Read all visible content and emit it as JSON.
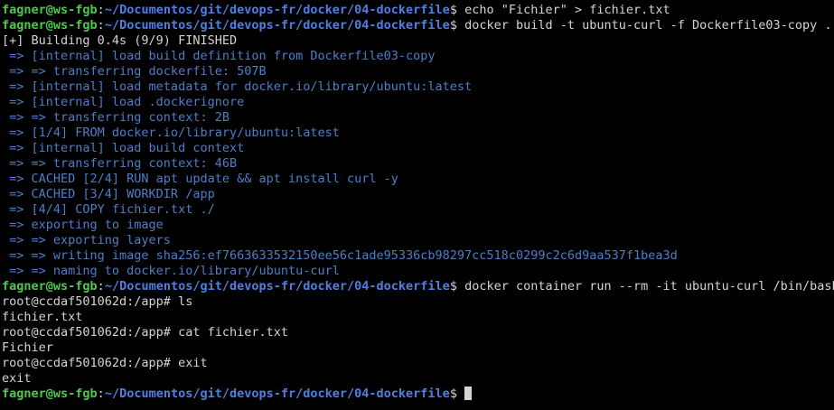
{
  "colors": {
    "background": "#000000",
    "user_host": "#4ec94e",
    "path": "#4f7fe3",
    "text": "#d4d4d4",
    "build_output": "#4e7ec9"
  },
  "terminal": {
    "prompt_user": "fagner@ws-fgb",
    "prompt_sep": ":",
    "prompt_path": "~/Documentos/git/devops-fr/docker/04-dockerfile",
    "prompt_dollar": "$ ",
    "container_prompt": "root@ccdaf501062d:/app# ",
    "lines": [
      {
        "type": "prompt",
        "command": "echo \"Fichier\" > fichier.txt"
      },
      {
        "type": "prompt",
        "command": "docker build -t ubuntu-curl -f Dockerfile03-copy ."
      },
      {
        "type": "plain",
        "text": "[+] Building 0.4s (9/9) FINISHED"
      },
      {
        "type": "build",
        "text": " => [internal] load build definition from Dockerfile03-copy"
      },
      {
        "type": "build",
        "text": " => => transferring dockerfile: 507B"
      },
      {
        "type": "build",
        "text": " => [internal] load metadata for docker.io/library/ubuntu:latest"
      },
      {
        "type": "build",
        "text": " => [internal] load .dockerignore"
      },
      {
        "type": "build",
        "text": " => => transferring context: 2B"
      },
      {
        "type": "build",
        "text": " => [1/4] FROM docker.io/library/ubuntu:latest"
      },
      {
        "type": "build",
        "text": " => [internal] load build context"
      },
      {
        "type": "build",
        "text": " => => transferring context: 46B"
      },
      {
        "type": "build",
        "text": " => CACHED [2/4] RUN apt update && apt install curl -y"
      },
      {
        "type": "build",
        "text": " => CACHED [3/4] WORKDIR /app"
      },
      {
        "type": "build",
        "text": " => [4/4] COPY fichier.txt ./"
      },
      {
        "type": "build",
        "text": " => exporting to image"
      },
      {
        "type": "build",
        "text": " => => exporting layers"
      },
      {
        "type": "build",
        "text": " => => writing image sha256:ef7663633532150ee56c1ade95336cb98297cc518c0299c2c6d9aa537f1bea3d"
      },
      {
        "type": "build",
        "text": " => => naming to docker.io/library/ubuntu-curl"
      },
      {
        "type": "prompt",
        "command": "docker container run --rm -it ubuntu-curl /bin/bash"
      },
      {
        "type": "container",
        "command": "ls"
      },
      {
        "type": "plain",
        "text": "fichier.txt"
      },
      {
        "type": "container",
        "command": "cat fichier.txt"
      },
      {
        "type": "plain",
        "text": "Fichier"
      },
      {
        "type": "container",
        "command": "exit"
      },
      {
        "type": "plain",
        "text": "exit"
      },
      {
        "type": "prompt-cursor",
        "command": ""
      }
    ]
  }
}
